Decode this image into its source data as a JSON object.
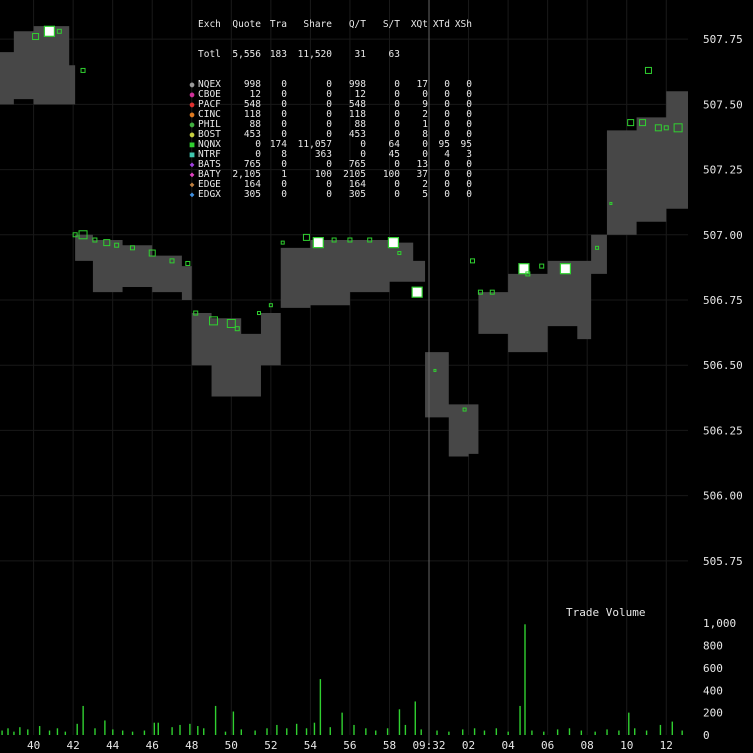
{
  "legend": {
    "headers": [
      "Exch",
      "Quote",
      "Tra",
      "Share",
      "Q/T",
      "S/T",
      "XQt",
      "XTd",
      "XSh"
    ],
    "total": {
      "label": "Totl",
      "quote": "5,556",
      "tra": "183",
      "share": "11,520",
      "qt": "31",
      "st": "63"
    },
    "rows": [
      {
        "ex": "NQEX",
        "quote": "998",
        "tra": "0",
        "share": "0",
        "qt": "998",
        "st": "0",
        "xq": "17",
        "xt": "0",
        "xs": "0",
        "color": "#9a9a9a",
        "marker": "●"
      },
      {
        "ex": "CBOE",
        "quote": "12",
        "tra": "0",
        "share": "0",
        "qt": "12",
        "st": "0",
        "xq": "0",
        "xt": "0",
        "xs": "0",
        "color": "#d0309a",
        "marker": "●"
      },
      {
        "ex": "PACF",
        "quote": "548",
        "tra": "0",
        "share": "0",
        "qt": "548",
        "st": "0",
        "xq": "9",
        "xt": "0",
        "xs": "0",
        "color": "#e03030",
        "marker": "●"
      },
      {
        "ex": "CINC",
        "quote": "118",
        "tra": "0",
        "share": "0",
        "qt": "118",
        "st": "0",
        "xq": "2",
        "xt": "0",
        "xs": "0",
        "color": "#e07a20",
        "marker": "●"
      },
      {
        "ex": "PHIL",
        "quote": "88",
        "tra": "0",
        "share": "0",
        "qt": "88",
        "st": "0",
        "xq": "1",
        "xt": "0",
        "xs": "0",
        "color": "#40b040",
        "marker": "●"
      },
      {
        "ex": "BOST",
        "quote": "453",
        "tra": "0",
        "share": "0",
        "qt": "453",
        "st": "0",
        "xq": "8",
        "xt": "0",
        "xs": "0",
        "color": "#c8d040",
        "marker": "●"
      },
      {
        "ex": "NQNX",
        "quote": "0",
        "tra": "174",
        "share": "11,057",
        "qt": "0",
        "st": "64",
        "xq": "0",
        "xt": "95",
        "xs": "95",
        "color": "#30d030",
        "marker": "■"
      },
      {
        "ex": "NTRF",
        "quote": "0",
        "tra": "8",
        "share": "363",
        "qt": "0",
        "st": "45",
        "xq": "0",
        "xt": "4",
        "xs": "3",
        "color": "#40c8b0",
        "marker": "■"
      },
      {
        "ex": "BATS",
        "quote": "765",
        "tra": "0",
        "share": "0",
        "qt": "765",
        "st": "0",
        "xq": "13",
        "xt": "0",
        "xs": "0",
        "color": "#a040e0",
        "marker": "◆"
      },
      {
        "ex": "BATY",
        "quote": "2,105",
        "tra": "1",
        "share": "100",
        "qt": "2105",
        "st": "100",
        "xq": "37",
        "xt": "0",
        "xs": "0",
        "color": "#e040c0",
        "marker": "◆"
      },
      {
        "ex": "EDGE",
        "quote": "164",
        "tra": "0",
        "share": "0",
        "qt": "164",
        "st": "0",
        "xq": "2",
        "xt": "0",
        "xs": "0",
        "color": "#c08040",
        "marker": "◆"
      },
      {
        "ex": "EDGX",
        "quote": "305",
        "tra": "0",
        "share": "0",
        "qt": "305",
        "st": "0",
        "xq": "5",
        "xt": "0",
        "xs": "0",
        "color": "#4090e0",
        "marker": "◆"
      }
    ]
  },
  "chart_data": [
    {
      "type": "area",
      "ylim": [
        505.6,
        507.9
      ],
      "yticks": [
        "507.75",
        "507.50",
        "507.25",
        "507.00",
        "506.75",
        "506.50",
        "506.25",
        "506.00",
        "505.75"
      ],
      "ytick_values": [
        507.75,
        507.5,
        507.25,
        507.0,
        506.75,
        506.5,
        506.25,
        506.0,
        505.75
      ],
      "xtick_labels": [
        "40",
        "42",
        "44",
        "46",
        "48",
        "50",
        "52",
        "54",
        "56",
        "58",
        "09:32",
        "02",
        "04",
        "06",
        "08",
        "10",
        "12"
      ],
      "x_tick_minutes": [
        0,
        2,
        4,
        6,
        8,
        10,
        12,
        14,
        16,
        18,
        20,
        22,
        24,
        26,
        28,
        30,
        32
      ],
      "xlim_minutes": [
        -1.7,
        33.1
      ],
      "band_color": "#474747",
      "quote_band": [
        {
          "t": -1.7,
          "bid": 507.5,
          "ask": 507.7
        },
        {
          "t": -1.0,
          "bid": 507.52,
          "ask": 507.78
        },
        {
          "t": 0.0,
          "bid": 507.5,
          "ask": 507.8
        },
        {
          "t": 1.0,
          "bid": 507.5,
          "ask": 507.8
        },
        {
          "t": 1.8,
          "bid": 507.5,
          "ask": 507.65
        },
        {
          "t": 2.1,
          "bid": 506.9,
          "ask": 507.0
        },
        {
          "t": 3.0,
          "bid": 506.78,
          "ask": 506.98
        },
        {
          "t": 4.5,
          "bid": 506.8,
          "ask": 506.96
        },
        {
          "t": 6.0,
          "bid": 506.78,
          "ask": 506.92
        },
        {
          "t": 7.5,
          "bid": 506.75,
          "ask": 506.88
        },
        {
          "t": 8.0,
          "bid": 506.5,
          "ask": 506.7
        },
        {
          "t": 9.0,
          "bid": 506.38,
          "ask": 506.68
        },
        {
          "t": 10.5,
          "bid": 506.38,
          "ask": 506.62
        },
        {
          "t": 11.5,
          "bid": 506.5,
          "ask": 506.7
        },
        {
          "t": 12.5,
          "bid": 506.72,
          "ask": 506.95
        },
        {
          "t": 14.0,
          "bid": 506.73,
          "ask": 506.98
        },
        {
          "t": 16.0,
          "bid": 506.78,
          "ask": 506.98
        },
        {
          "t": 18.0,
          "bid": 506.82,
          "ask": 506.97
        },
        {
          "t": 19.2,
          "bid": 506.82,
          "ask": 506.9
        },
        {
          "t": 19.8,
          "bid": 506.3,
          "ask": 506.55
        },
        {
          "t": 21.0,
          "bid": 506.15,
          "ask": 506.35
        },
        {
          "t": 22.0,
          "bid": 506.16,
          "ask": 506.35
        },
        {
          "t": 22.5,
          "bid": 506.62,
          "ask": 506.78
        },
        {
          "t": 24.0,
          "bid": 506.55,
          "ask": 506.85
        },
        {
          "t": 26.0,
          "bid": 506.65,
          "ask": 506.9
        },
        {
          "t": 27.5,
          "bid": 506.6,
          "ask": 506.9
        },
        {
          "t": 28.2,
          "bid": 506.85,
          "ask": 507.0
        },
        {
          "t": 29.0,
          "bid": 507.0,
          "ask": 507.4
        },
        {
          "t": 30.5,
          "bid": 507.05,
          "ask": 507.45
        },
        {
          "t": 32.0,
          "bid": 507.1,
          "ask": 507.55
        },
        {
          "t": 33.1,
          "bid": 507.18,
          "ask": 507.55
        }
      ],
      "trades": [
        {
          "t": 0.8,
          "p": 507.78,
          "s": 10
        },
        {
          "t": 1.3,
          "p": 507.78,
          "s": 4
        },
        {
          "t": 0.1,
          "p": 507.76,
          "s": 6
        },
        {
          "t": 2.5,
          "p": 507.63,
          "s": 4
        },
        {
          "t": 2.1,
          "p": 507.0,
          "s": 4
        },
        {
          "t": 2.5,
          "p": 507.0,
          "s": 8
        },
        {
          "t": 3.1,
          "p": 506.98,
          "s": 4
        },
        {
          "t": 3.7,
          "p": 506.97,
          "s": 6
        },
        {
          "t": 4.2,
          "p": 506.96,
          "s": 4
        },
        {
          "t": 5.0,
          "p": 506.95,
          "s": 4
        },
        {
          "t": 6.0,
          "p": 506.93,
          "s": 6
        },
        {
          "t": 7.0,
          "p": 506.9,
          "s": 4
        },
        {
          "t": 7.8,
          "p": 506.89,
          "s": 4
        },
        {
          "t": 8.2,
          "p": 506.7,
          "s": 4
        },
        {
          "t": 9.1,
          "p": 506.67,
          "s": 8
        },
        {
          "t": 10.0,
          "p": 506.66,
          "s": 8
        },
        {
          "t": 10.3,
          "p": 506.64,
          "s": 4
        },
        {
          "t": 11.4,
          "p": 506.7,
          "s": 3
        },
        {
          "t": 12.0,
          "p": 506.73,
          "s": 3
        },
        {
          "t": 12.6,
          "p": 506.97,
          "s": 3
        },
        {
          "t": 13.8,
          "p": 506.99,
          "s": 6
        },
        {
          "t": 14.4,
          "p": 506.97,
          "s": 10
        },
        {
          "t": 15.2,
          "p": 506.98,
          "s": 4
        },
        {
          "t": 16.0,
          "p": 506.98,
          "s": 4
        },
        {
          "t": 17.0,
          "p": 506.98,
          "s": 4
        },
        {
          "t": 18.2,
          "p": 506.97,
          "s": 10
        },
        {
          "t": 18.5,
          "p": 506.93,
          "s": 3
        },
        {
          "t": 19.4,
          "p": 506.78,
          "s": 10
        },
        {
          "t": 20.3,
          "p": 506.48,
          "s": 2
        },
        {
          "t": 21.8,
          "p": 506.33,
          "s": 3
        },
        {
          "t": 22.2,
          "p": 506.9,
          "s": 4
        },
        {
          "t": 22.6,
          "p": 506.78,
          "s": 4
        },
        {
          "t": 23.2,
          "p": 506.78,
          "s": 4
        },
        {
          "t": 24.8,
          "p": 506.87,
          "s": 10
        },
        {
          "t": 25.0,
          "p": 506.85,
          "s": 4
        },
        {
          "t": 25.7,
          "p": 506.88,
          "s": 4
        },
        {
          "t": 26.9,
          "p": 506.87,
          "s": 10
        },
        {
          "t": 28.5,
          "p": 506.95,
          "s": 3
        },
        {
          "t": 29.2,
          "p": 507.12,
          "s": 2
        },
        {
          "t": 30.2,
          "p": 507.43,
          "s": 6
        },
        {
          "t": 30.8,
          "p": 507.43,
          "s": 6
        },
        {
          "t": 31.1,
          "p": 507.63,
          "s": 6
        },
        {
          "t": 31.6,
          "p": 507.41,
          "s": 6
        },
        {
          "t": 32.0,
          "p": 507.41,
          "s": 4
        },
        {
          "t": 32.6,
          "p": 507.41,
          "s": 8
        }
      ],
      "marker_color": "#30d030",
      "ylabel": "",
      "xlabel": ""
    },
    {
      "type": "bar",
      "title": "Trade Volume",
      "ylim": [
        0,
        1100
      ],
      "yticks": [
        "1,000",
        "800",
        "600",
        "400",
        "200",
        "0"
      ],
      "ytick_values": [
        1000,
        800,
        600,
        400,
        200,
        0
      ],
      "bar_color": "#30d030",
      "volumes": [
        {
          "t": -1.6,
          "v": 40
        },
        {
          "t": -1.3,
          "v": 60
        },
        {
          "t": -1.0,
          "v": 30
        },
        {
          "t": -0.7,
          "v": 70
        },
        {
          "t": -0.3,
          "v": 50
        },
        {
          "t": 0.3,
          "v": 80
        },
        {
          "t": 0.8,
          "v": 40
        },
        {
          "t": 1.2,
          "v": 60
        },
        {
          "t": 1.6,
          "v": 30
        },
        {
          "t": 2.2,
          "v": 100
        },
        {
          "t": 2.5,
          "v": 260
        },
        {
          "t": 3.1,
          "v": 60
        },
        {
          "t": 3.6,
          "v": 130
        },
        {
          "t": 4.0,
          "v": 50
        },
        {
          "t": 4.5,
          "v": 40
        },
        {
          "t": 5.0,
          "v": 30
        },
        {
          "t": 5.6,
          "v": 40
        },
        {
          "t": 6.1,
          "v": 110
        },
        {
          "t": 6.3,
          "v": 110
        },
        {
          "t": 7.0,
          "v": 70
        },
        {
          "t": 7.4,
          "v": 90
        },
        {
          "t": 7.9,
          "v": 100
        },
        {
          "t": 8.3,
          "v": 80
        },
        {
          "t": 8.6,
          "v": 60
        },
        {
          "t": 9.2,
          "v": 260
        },
        {
          "t": 9.7,
          "v": 30
        },
        {
          "t": 10.1,
          "v": 210
        },
        {
          "t": 10.5,
          "v": 50
        },
        {
          "t": 11.2,
          "v": 40
        },
        {
          "t": 11.8,
          "v": 60
        },
        {
          "t": 12.3,
          "v": 90
        },
        {
          "t": 12.8,
          "v": 60
        },
        {
          "t": 13.3,
          "v": 100
        },
        {
          "t": 13.8,
          "v": 60
        },
        {
          "t": 14.2,
          "v": 110
        },
        {
          "t": 14.5,
          "v": 500
        },
        {
          "t": 15.0,
          "v": 70
        },
        {
          "t": 15.6,
          "v": 200
        },
        {
          "t": 16.2,
          "v": 90
        },
        {
          "t": 16.8,
          "v": 60
        },
        {
          "t": 17.3,
          "v": 40
        },
        {
          "t": 17.9,
          "v": 60
        },
        {
          "t": 18.5,
          "v": 230
        },
        {
          "t": 18.8,
          "v": 90
        },
        {
          "t": 19.3,
          "v": 300
        },
        {
          "t": 19.6,
          "v": 50
        },
        {
          "t": 20.4,
          "v": 40
        },
        {
          "t": 21.0,
          "v": 30
        },
        {
          "t": 21.7,
          "v": 50
        },
        {
          "t": 22.3,
          "v": 60
        },
        {
          "t": 22.8,
          "v": 40
        },
        {
          "t": 23.4,
          "v": 60
        },
        {
          "t": 24.0,
          "v": 30
        },
        {
          "t": 24.6,
          "v": 260
        },
        {
          "t": 24.85,
          "v": 990
        },
        {
          "t": 25.2,
          "v": 40
        },
        {
          "t": 25.8,
          "v": 30
        },
        {
          "t": 26.5,
          "v": 50
        },
        {
          "t": 27.1,
          "v": 60
        },
        {
          "t": 27.7,
          "v": 40
        },
        {
          "t": 28.4,
          "v": 30
        },
        {
          "t": 29.0,
          "v": 50
        },
        {
          "t": 29.6,
          "v": 40
        },
        {
          "t": 30.1,
          "v": 200
        },
        {
          "t": 30.4,
          "v": 60
        },
        {
          "t": 31.0,
          "v": 40
        },
        {
          "t": 31.7,
          "v": 90
        },
        {
          "t": 32.3,
          "v": 120
        },
        {
          "t": 32.8,
          "v": 40
        }
      ]
    }
  ]
}
